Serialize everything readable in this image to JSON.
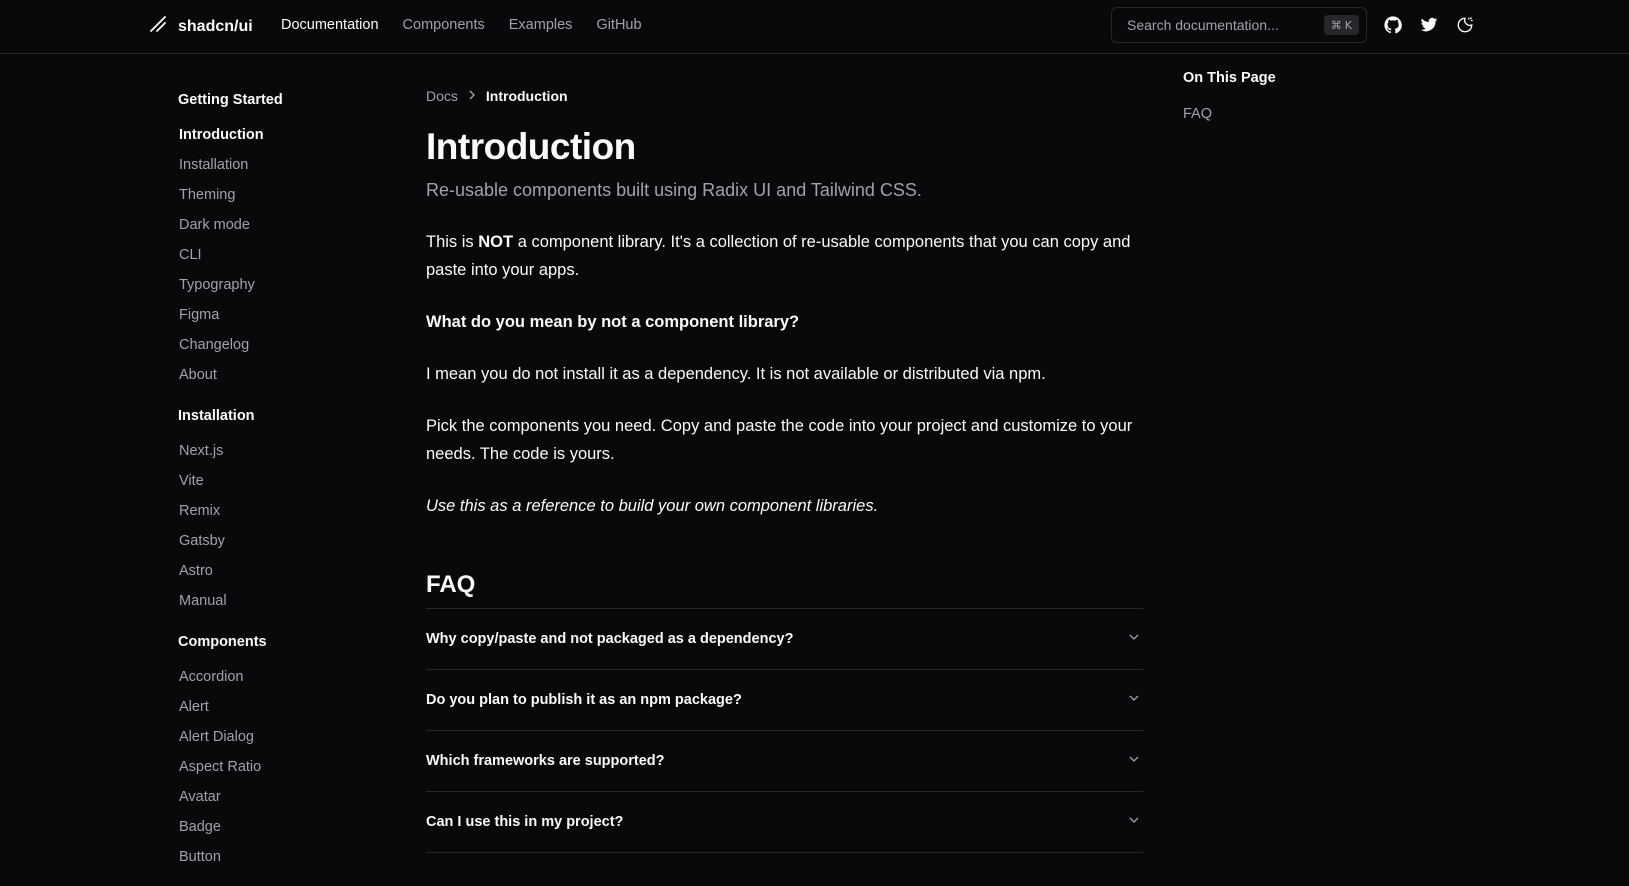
{
  "header": {
    "brand": "shadcn/ui",
    "nav": [
      {
        "label": "Documentation",
        "active": true
      },
      {
        "label": "Components",
        "active": false
      },
      {
        "label": "Examples",
        "active": false
      },
      {
        "label": "GitHub",
        "active": false
      }
    ],
    "search_placeholder": "Search documentation...",
    "shortcut_symbol": "⌘",
    "shortcut_key": "K",
    "icons": [
      "github-icon",
      "twitter-icon",
      "theme-toggle-icon"
    ]
  },
  "sidebar": {
    "groups": [
      {
        "heading": "Getting Started",
        "items": [
          "Introduction",
          "Installation",
          "Theming",
          "Dark mode",
          "CLI",
          "Typography",
          "Figma",
          "Changelog",
          "About"
        ]
      },
      {
        "heading": "Installation",
        "items": [
          "Next.js",
          "Vite",
          "Remix",
          "Gatsby",
          "Astro",
          "Manual"
        ]
      },
      {
        "heading": "Components",
        "items": [
          "Accordion",
          "Alert",
          "Alert Dialog",
          "Aspect Ratio",
          "Avatar",
          "Badge",
          "Button"
        ]
      }
    ],
    "active_item": "Introduction"
  },
  "breadcrumb": {
    "parent": "Docs",
    "current": "Introduction"
  },
  "page": {
    "title": "Introduction",
    "subtitle": "Re-usable components built using Radix UI and Tailwind CSS.",
    "intro_before": "This is ",
    "intro_bold": "NOT",
    "intro_after": " a component library. It's a collection of re-usable components that you can copy and paste into your apps.",
    "question": "What do you mean by not a component library?",
    "answer1": "I mean you do not install it as a dependency. It is not available or distributed via npm.",
    "answer2": "Pick the components you need. Copy and paste the code into your project and customize to your needs. The code is yours.",
    "note": "Use this as a reference to build your own component libraries.",
    "faq_heading": "FAQ",
    "faq_items": [
      "Why copy/paste and not packaged as a dependency?",
      "Do you plan to publish it as an npm package?",
      "Which frameworks are supported?",
      "Can I use this in my project?"
    ]
  },
  "toc": {
    "heading": "On This Page",
    "items": [
      "FAQ"
    ]
  }
}
